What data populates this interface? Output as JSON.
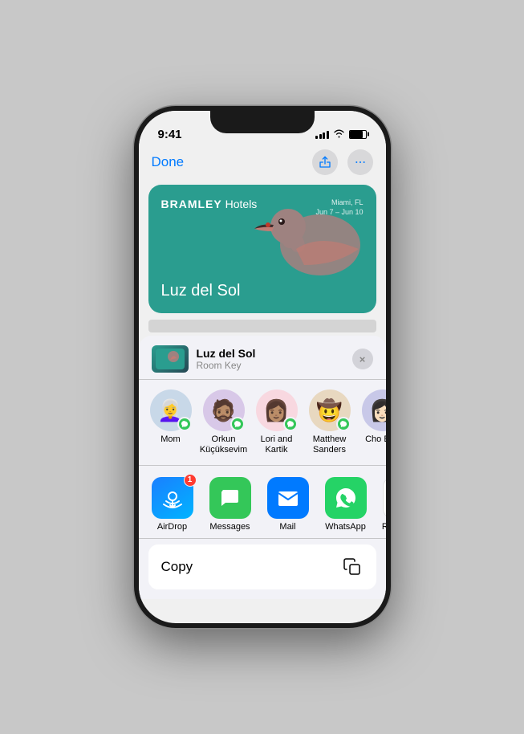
{
  "statusBar": {
    "time": "9:41",
    "batteryLevel": 80
  },
  "topNav": {
    "doneLabel": "Done"
  },
  "hotelCard": {
    "brandBold": "BRAMLEY",
    "brandLight": " Hotels",
    "location": "Miami, FL",
    "dates": "Jun 7 – Jun 10",
    "guestName": "Luz del Sol"
  },
  "shareSheet": {
    "thumbLabel": "BRAMLEY Hotels",
    "title": "Luz del Sol",
    "subtitle": "Room Key",
    "closeLabel": "×"
  },
  "contacts": [
    {
      "id": "mom",
      "name": "Mom",
      "emoji": "👩‍🦳",
      "bgClass": "av-mom"
    },
    {
      "id": "orkun",
      "name": "Orkun Küçüksevim",
      "emoji": "🧔🏽",
      "bgClass": "av-orkun"
    },
    {
      "id": "lori",
      "name": "Lori and Kartik",
      "emoji": "👩🏽",
      "bgClass": "av-lori"
    },
    {
      "id": "matthew",
      "name": "Matthew Sanders",
      "emoji": "🤠",
      "bgClass": "av-matthew"
    },
    {
      "id": "cho",
      "name": "Cho Boo",
      "emoji": "👩🏻",
      "bgClass": "av-cho"
    }
  ],
  "apps": [
    {
      "id": "airdrop",
      "label": "AirDrop",
      "icon": "📡",
      "bgClass": "airdrop-bg",
      "badge": "1"
    },
    {
      "id": "messages",
      "label": "Messages",
      "icon": "💬",
      "bgClass": "messages-bg",
      "badge": ""
    },
    {
      "id": "mail",
      "label": "Mail",
      "icon": "✉️",
      "bgClass": "mail-bg",
      "badge": ""
    },
    {
      "id": "whatsapp",
      "label": "WhatsApp",
      "icon": "📱",
      "bgClass": "whatsapp-bg",
      "badge": ""
    },
    {
      "id": "reminders",
      "label": "Reminders",
      "icon": "🔴",
      "bgClass": "reminders-bg",
      "badge": ""
    }
  ],
  "copyRow": {
    "label": "Copy"
  }
}
